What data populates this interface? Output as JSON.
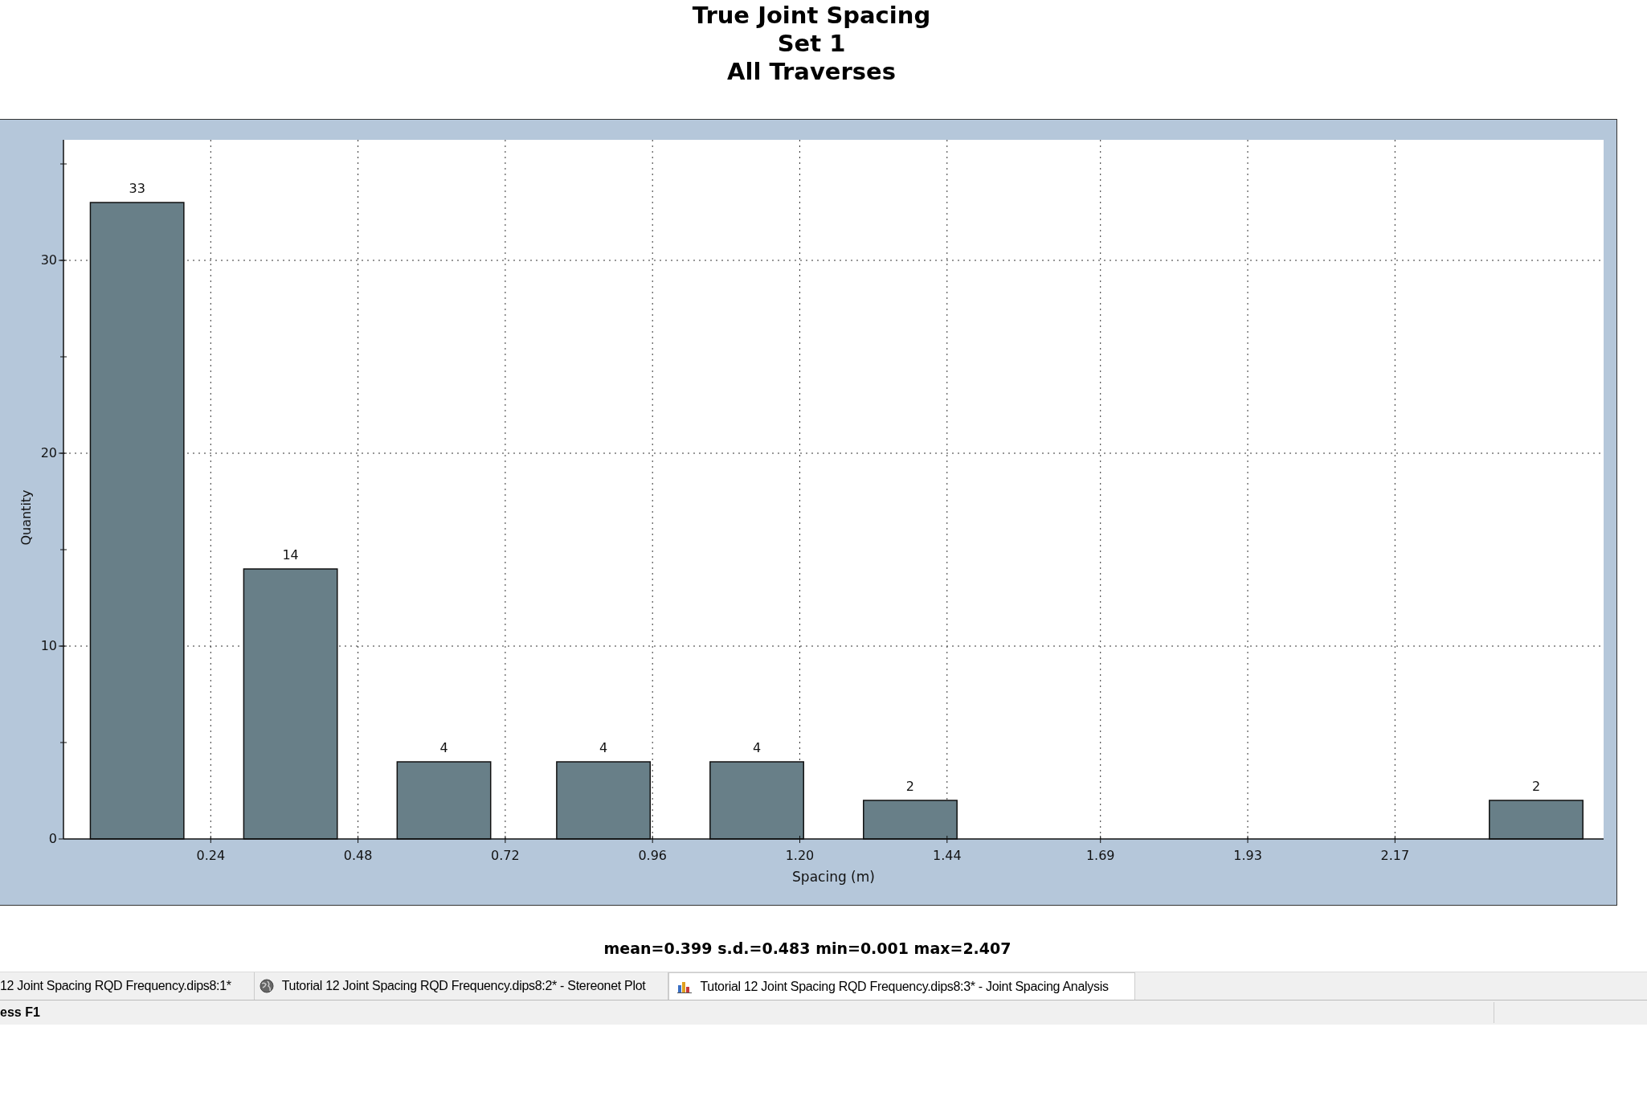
{
  "chart": {
    "title_lines": [
      "True Joint Spacing",
      "Set 1",
      "All Traverses"
    ],
    "chart_data": {
      "type": "bar",
      "xlabel": "Spacing (m)",
      "ylabel": "Quantity",
      "x": [
        0.12,
        0.37,
        0.62,
        0.88,
        1.13,
        1.38,
        1.64,
        1.89,
        2.15,
        2.4
      ],
      "values": [
        33,
        14,
        4,
        4,
        4,
        2,
        0,
        0,
        0,
        2
      ],
      "xlim": [
        0,
        2.51
      ],
      "ylim": [
        0,
        36.25
      ],
      "xticks": [
        {
          "value": 0.24,
          "label": "0.24"
        },
        {
          "value": 0.48,
          "label": "0.48"
        },
        {
          "value": 0.72,
          "label": "0.72"
        },
        {
          "value": 0.96,
          "label": "0.96"
        },
        {
          "value": 1.2,
          "label": "1.20"
        },
        {
          "value": 1.44,
          "label": "1.44"
        },
        {
          "value": 1.69,
          "label": "1.69"
        },
        {
          "value": 1.93,
          "label": "1.93"
        },
        {
          "value": 2.17,
          "label": "2.17"
        }
      ],
      "yticks": [
        0,
        10,
        20,
        30
      ],
      "value_labels": [
        "33",
        "14",
        "4",
        "4",
        "4",
        "2",
        null,
        null,
        null,
        "2"
      ],
      "grid": true
    },
    "stats": "mean=0.399 s.d.=0.483 min=0.001 max=2.407"
  },
  "tabs": [
    {
      "label": "12 Joint Spacing RQD Frequency.dips8:1*",
      "kind": "plain",
      "selected": false
    },
    {
      "label": "Tutorial 12 Joint Spacing RQD Frequency.dips8:2* - Stereonet Plot",
      "kind": "globe",
      "selected": false
    },
    {
      "label": "Tutorial 12 Joint Spacing RQD Frequency.dips8:3* - Joint Spacing Analysis",
      "kind": "chart",
      "selected": true
    }
  ],
  "status_bar": {
    "text": "ess F1"
  }
}
